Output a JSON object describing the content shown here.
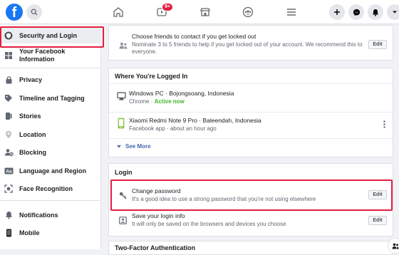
{
  "nav": {
    "logo_letter": "f",
    "notification_badge": "9+"
  },
  "sidebar": {
    "items": [
      {
        "label": "Security and Login"
      },
      {
        "label": "Your Facebook Information"
      },
      {
        "label": "Privacy"
      },
      {
        "label": "Timeline and Tagging"
      },
      {
        "label": "Stories"
      },
      {
        "label": "Location"
      },
      {
        "label": "Blocking"
      },
      {
        "label": "Language and Region"
      },
      {
        "label": "Face Recognition"
      },
      {
        "label": "Notifications"
      },
      {
        "label": "Mobile"
      }
    ]
  },
  "trusted_contacts": {
    "title": "Choose friends to contact if you get locked out",
    "desc": "Nominate 3 to 5 friends to help if you get locked out of your account. We recommend this to everyone.",
    "edit_label": "Edit"
  },
  "logged_in": {
    "title": "Where You're Logged In",
    "sessions": [
      {
        "device": "Windows PC · Bojongsoang, Indonesia",
        "app": "Chrome",
        "sep": " · ",
        "status": "Active now"
      },
      {
        "device": "Xiaomi Redmi Note 9 Pro · Baleendah, Indonesia",
        "app": "Facebook app · about an hour ago"
      }
    ],
    "see_more": "See More"
  },
  "login": {
    "title": "Login",
    "change_password": {
      "title": "Change password",
      "desc": "It's a good idea to use a strong password that you're not using elsewhere",
      "edit_label": "Edit"
    },
    "save_login": {
      "title": "Save your login info",
      "desc": "It will only be saved on the browsers and devices you choose",
      "edit_label": "Edit"
    }
  },
  "two_factor": {
    "title": "Two-Factor Authentication"
  },
  "colors": {
    "brand": "#1877f2",
    "active_green": "#42b72a",
    "highlight": "#e41e3f"
  }
}
